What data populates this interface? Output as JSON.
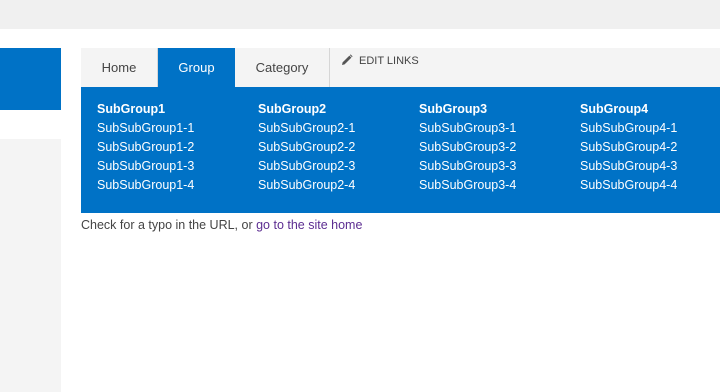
{
  "nav": {
    "tabs": [
      {
        "label": "Home",
        "active": false
      },
      {
        "label": "Group",
        "active": true
      },
      {
        "label": "Category",
        "active": false
      }
    ],
    "edit_links": {
      "label": "EDIT LINKS",
      "icon": "pencil-icon"
    }
  },
  "menu": {
    "groups": [
      {
        "title": "SubGroup1",
        "items": [
          "SubSubGroup1-1",
          "SubSubGroup1-2",
          "SubSubGroup1-3",
          "SubSubGroup1-4"
        ]
      },
      {
        "title": "SubGroup2",
        "items": [
          "SubSubGroup2-1",
          "SubSubGroup2-2",
          "SubSubGroup2-3",
          "SubSubGroup2-4"
        ]
      },
      {
        "title": "SubGroup3",
        "items": [
          "SubSubGroup3-1",
          "SubSubGroup3-2",
          "SubSubGroup3-3",
          "SubSubGroup3-4"
        ]
      },
      {
        "title": "SubGroup4",
        "items": [
          "SubSubGroup4-1",
          "SubSubGroup4-2",
          "SubSubGroup4-3",
          "SubSubGroup4-4"
        ]
      }
    ]
  },
  "message": {
    "text": "Check for a typo in the URL, or",
    "link_label": "go to the site home"
  },
  "colors": {
    "accent": "#0072c6",
    "link": "#5c2d91",
    "text": "#444444",
    "tab_bar": "#f4f4f4"
  }
}
